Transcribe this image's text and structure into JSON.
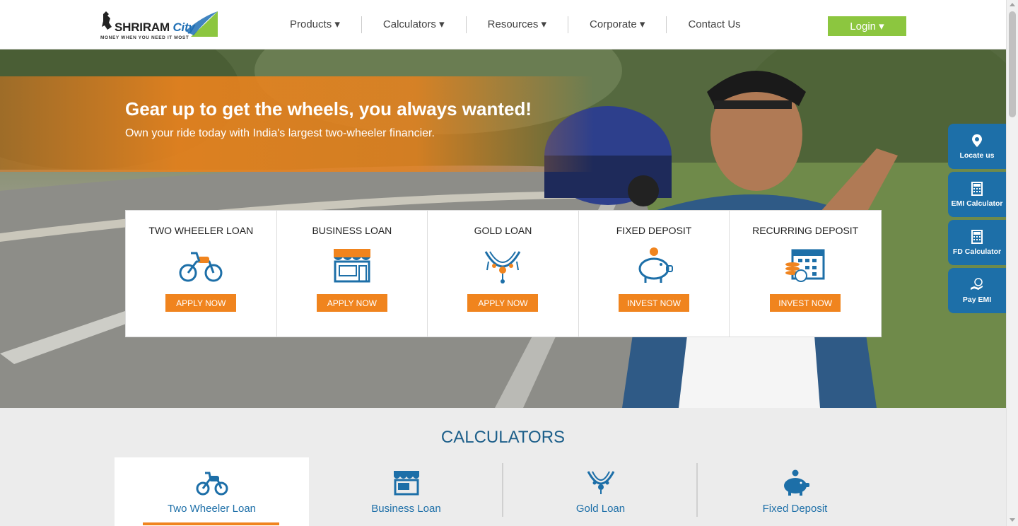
{
  "header": {
    "logo": {
      "name": "SHRIRAM",
      "city": "City",
      "tagline": "MONEY WHEN YOU NEED IT MOST"
    },
    "nav": [
      {
        "label": "Products ▾"
      },
      {
        "label": "Calculators ▾"
      },
      {
        "label": "Resources ▾"
      },
      {
        "label": "Corporate ▾"
      },
      {
        "label": "Contact Us"
      }
    ],
    "login_label": "Login ▾"
  },
  "hero": {
    "title": "Gear up to get the wheels, you always wanted!",
    "subtitle": "Own your ride today with India's largest two-wheeler financier."
  },
  "products": [
    {
      "title": "TWO WHEELER LOAN",
      "button": "APPLY NOW",
      "icon": "motorcycle-icon"
    },
    {
      "title": "BUSINESS LOAN",
      "button": "APPLY NOW",
      "icon": "shop-icon"
    },
    {
      "title": "GOLD LOAN",
      "button": "APPLY NOW",
      "icon": "gold-necklace-icon"
    },
    {
      "title": "FIXED DEPOSIT",
      "button": "INVEST NOW",
      "icon": "piggy-bank-icon"
    },
    {
      "title": "RECURRING DEPOSIT",
      "button": "INVEST NOW",
      "icon": "calendar-coins-icon"
    }
  ],
  "side_widgets": [
    {
      "label": "Locate us",
      "icon": "location-pin-icon"
    },
    {
      "label": "EMI Calculator",
      "icon": "calculator-icon"
    },
    {
      "label": "FD Calculator",
      "icon": "calculator-icon"
    },
    {
      "label": "Pay EMI",
      "icon": "hand-coin-icon"
    }
  ],
  "calculators": {
    "heading": "CALCULATORS",
    "tabs": [
      {
        "label": "Two Wheeler Loan",
        "icon": "motorcycle-icon",
        "active": true
      },
      {
        "label": "Business Loan",
        "icon": "shop-icon",
        "active": false
      },
      {
        "label": "Gold Loan",
        "icon": "gold-necklace-icon",
        "active": false
      },
      {
        "label": "Fixed Deposit",
        "icon": "piggy-bank-icon",
        "active": false
      }
    ]
  },
  "colors": {
    "accent_orange": "#f0841e",
    "brand_blue": "#1d6fa8",
    "login_green": "#8cc63f"
  }
}
